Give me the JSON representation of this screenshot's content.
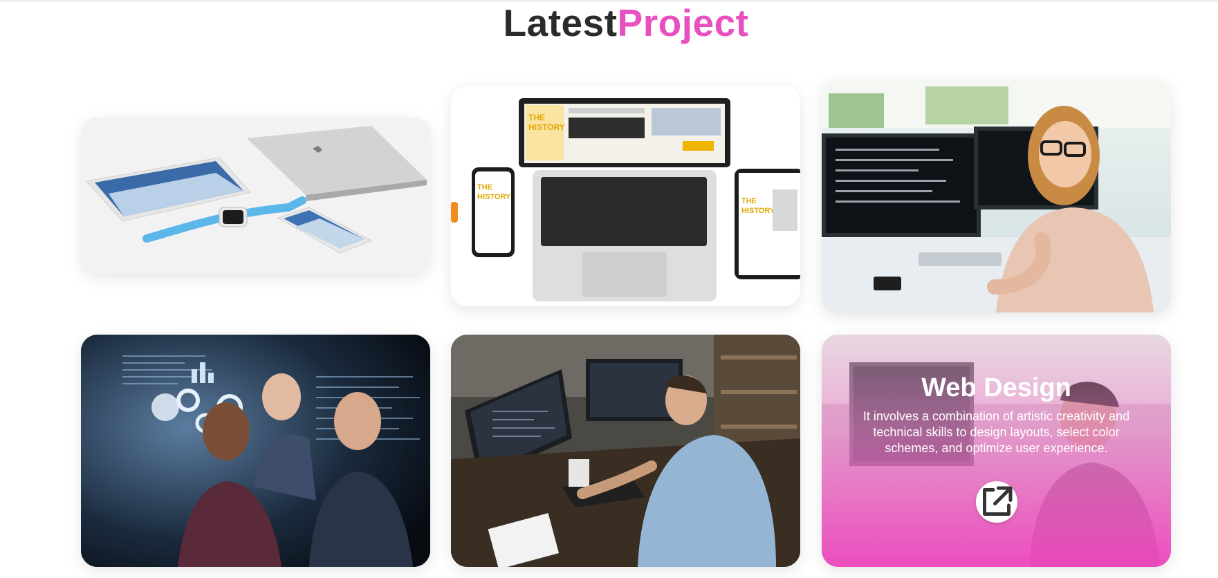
{
  "section": {
    "title_part1": "Latest",
    "title_part2": "Project"
  },
  "colors": {
    "accent": "#e84fc1",
    "heading_dark": "#2b2b2b"
  },
  "projects": [
    {
      "name": "apple-devices"
    },
    {
      "name": "laptop-phone-tablet"
    },
    {
      "name": "woman-at-monitors"
    },
    {
      "name": "team-with-holograms"
    },
    {
      "name": "developer-at-desk"
    },
    {
      "name": "web-design",
      "overlay": {
        "title": "Web Design",
        "description": "It involves a combination of artistic creativity and technical skills to design layouts, select color schemes, and optimize user experience.",
        "link_icon": "external-link-icon"
      }
    }
  ]
}
